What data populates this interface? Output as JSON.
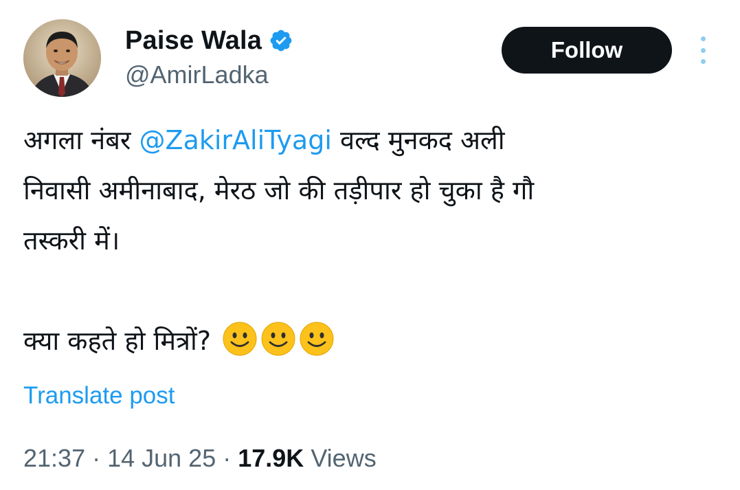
{
  "author": {
    "display_name": "Paise Wala",
    "handle": "@AmirLadka",
    "verified": true,
    "avatar_icon": "profile-photo"
  },
  "follow_button": {
    "label": "Follow"
  },
  "more_icon": "more-options-vertical-icon",
  "post": {
    "line1_before": "अगला नंबर ",
    "mention": "@ZakirAliTyagi",
    "line1_after": " वल्द मुनकद अली",
    "line2": "निवासी अमीनाबाद, मेरठ जो की तड़ीपार हो चुका है गौ",
    "line3": "तस्करी में।",
    "line4": "क्या कहते हो मित्रों?",
    "emojis": [
      "slightly-smiling-face",
      "slightly-smiling-face",
      "slightly-smiling-face"
    ]
  },
  "translate": {
    "label": "Translate post"
  },
  "meta": {
    "time": "21:37",
    "separator": " · ",
    "date": "14 Jun 25",
    "views_count": "17.9K",
    "views_label": " Views"
  },
  "colors": {
    "accent": "#1d9bf0",
    "text": "#0f1419",
    "secondary": "#536471",
    "button_bg": "#0f1419"
  }
}
